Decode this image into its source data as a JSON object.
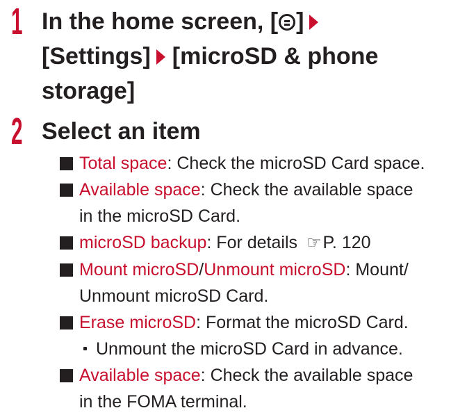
{
  "steps": [
    {
      "number": "1",
      "line1_before": "In the home screen, [",
      "line1_key_icon": "menu-key-icon",
      "line1_after": "]",
      "line2_a": "[Settings]",
      "line2_b": "[microSD & phone",
      "line3": "storage]"
    },
    {
      "number": "2",
      "title": "Select an item"
    }
  ],
  "items": [
    {
      "label": "Total space",
      "text": ": Check the microSD Card space."
    },
    {
      "label": "Available space",
      "text": ": Check the available space",
      "cont": "in the microSD Card."
    },
    {
      "label": "microSD backup",
      "text": ": For details ",
      "ref_icon": "☞",
      "ref": "P. 120"
    },
    {
      "label": "Mount microSD",
      "sep": "/",
      "label2": "Unmount microSD",
      "text": ": Mount/",
      "cont": "Unmount microSD Card."
    },
    {
      "label": "Erase microSD",
      "text": ": Format the microSD Card.",
      "note": "Unmount the microSD Card in advance."
    },
    {
      "label": "Available space",
      "text": ": Check the available space",
      "cont": "in the FOMA terminal."
    }
  ],
  "colors": {
    "accent": "#c8102e",
    "text": "#231f20"
  }
}
